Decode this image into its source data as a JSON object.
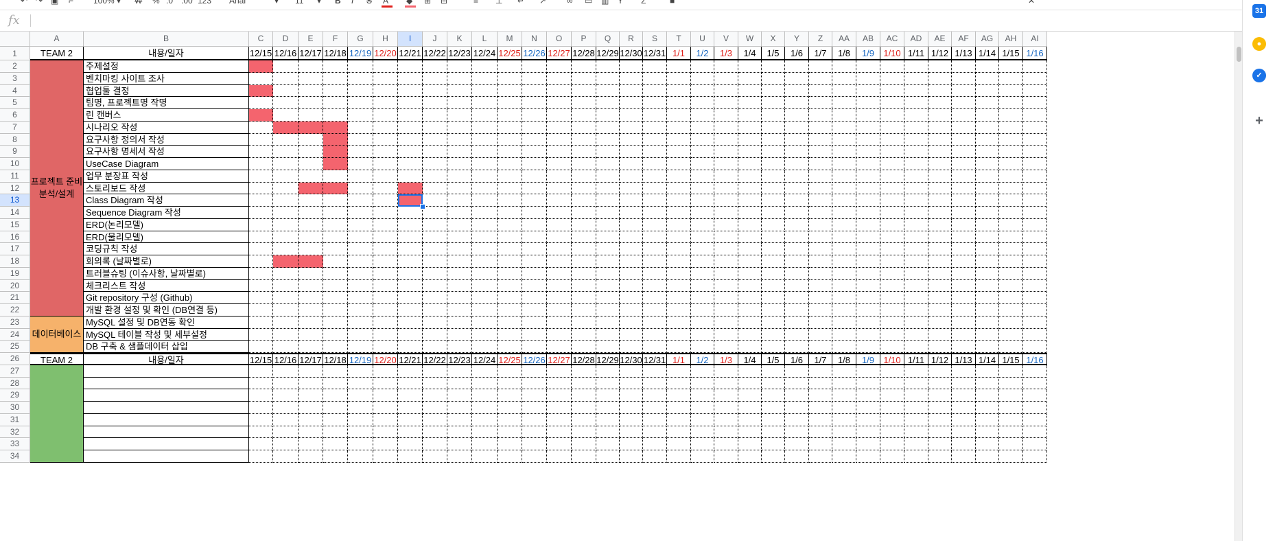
{
  "toolbar": {
    "zoom": "100%",
    "percent": "%",
    "dec_less": ".0",
    "dec_more": ".00",
    "format_123": "123",
    "font": "Arial",
    "font_size": "11"
  },
  "formula_bar": {
    "label": "fx",
    "value": ""
  },
  "columns": [
    "A",
    "B",
    "C",
    "D",
    "E",
    "F",
    "G",
    "H",
    "I",
    "J",
    "K",
    "L",
    "M",
    "N",
    "O",
    "P",
    "Q",
    "R",
    "S",
    "T",
    "U",
    "V",
    "W",
    "X",
    "Y",
    "Z",
    "AA",
    "AB",
    "AC",
    "AD",
    "AE",
    "AF",
    "AG",
    "AH",
    "AI"
  ],
  "rows": [
    "1",
    "2",
    "3",
    "4",
    "5",
    "6",
    "7",
    "8",
    "9",
    "10",
    "11",
    "12",
    "13",
    "14",
    "15",
    "16",
    "17",
    "18",
    "19",
    "20",
    "21",
    "22",
    "23",
    "24",
    "25",
    "26",
    "27",
    "28",
    "29",
    "30",
    "31",
    "32",
    "33",
    "34"
  ],
  "header": {
    "team": "TEAM 2",
    "content_date": "내용/일자"
  },
  "dates": [
    "12/15",
    "12/16",
    "12/17",
    "12/18",
    "12/19",
    "12/20",
    "12/21",
    "12/22",
    "12/23",
    "12/24",
    "12/25",
    "12/26",
    "12/27",
    "12/28",
    "12/29",
    "12/30",
    "12/31",
    "1/1",
    "1/2",
    "1/3",
    "1/4",
    "1/5",
    "1/6",
    "1/7",
    "1/8",
    "1/9",
    "1/10",
    "1/11",
    "1/12",
    "1/13",
    "1/14",
    "1/15",
    "1/16"
  ],
  "date_colors": [
    "#000000",
    "#000000",
    "#000000",
    "#000000",
    "#1565c0",
    "#e0201b",
    "#000000",
    "#000000",
    "#000000",
    "#000000",
    "#e0201b",
    "#1565c0",
    "#e0201b",
    "#000000",
    "#000000",
    "#000000",
    "#000000",
    "#e0201b",
    "#1565c0",
    "#e0201b",
    "#000000",
    "#000000",
    "#000000",
    "#000000",
    "#000000",
    "#1565c0",
    "#e0201b",
    "#000000",
    "#000000",
    "#000000",
    "#000000",
    "#000000",
    "#1565c0"
  ],
  "groups": {
    "prep": {
      "label": "프로젝트 준비 분석/설계",
      "color": "#e06666"
    },
    "db": {
      "label": "데이터베이스",
      "color": "#f6b26b"
    },
    "next": {
      "label": "",
      "color": "#7fbf6f"
    }
  },
  "tasks": [
    "주제설정",
    "벤치마킹 사이트 조사",
    "협업툴 결정",
    "팀명, 프로젝트명 작명",
    "린 캔버스",
    "시나리오 작성",
    "요구사항 정의서 작성",
    "요구사항 명세서 작성",
    "UseCase Diagram",
    "업무 분장표 작성",
    "스토리보드 작성",
    "Class Diagram 작성",
    "Sequence Diagram 작성",
    "ERD(논리모델)",
    "ERD(물리모델)",
    "코딩규칙 작성",
    "회의록 (날짜별로)",
    "트러블슈팅 (이슈사항, 날짜별로)",
    "체크리스트 작성",
    "Git repository 구성 (Github)",
    "개발 환경 설정 및 확인 (DB연결 등)",
    "MySQL 설정 및 DB연동 확인",
    "MySQL 테이블 작성 및 세부설정",
    "DB 구축 & 샘플데이터 삽입"
  ],
  "schedule": {
    "accent": "#f4646e",
    "bars": [
      {
        "task": "주제설정",
        "from": "12/15",
        "to": "12/15"
      },
      {
        "task": "협업툴 결정",
        "from": "12/15",
        "to": "12/15"
      },
      {
        "task": "린 캔버스",
        "from": "12/15",
        "to": "12/15"
      },
      {
        "task": "시나리오 작성",
        "from": "12/16",
        "to": "12/18"
      },
      {
        "task": "요구사항 정의서 작성",
        "from": "12/18",
        "to": "12/18"
      },
      {
        "task": "요구사항 명세서 작성",
        "from": "12/18",
        "to": "12/18"
      },
      {
        "task": "UseCase Diagram",
        "from": "12/18",
        "to": "12/18"
      },
      {
        "task": "스토리보드 작성",
        "from": "12/17",
        "to": "12/18"
      },
      {
        "task": "스토리보드 작성",
        "from": "12/21",
        "to": "12/21"
      },
      {
        "task": "Class Diagram 작성",
        "from": "12/21",
        "to": "12/21"
      },
      {
        "task": "회의록 (날짜별로)",
        "from": "12/16",
        "to": "12/17"
      }
    ],
    "selected": {
      "column": "I",
      "row": "13"
    }
  },
  "side_panel": [
    "calendar-icon",
    "keep-icon",
    "tasks-icon",
    "add-icon"
  ]
}
